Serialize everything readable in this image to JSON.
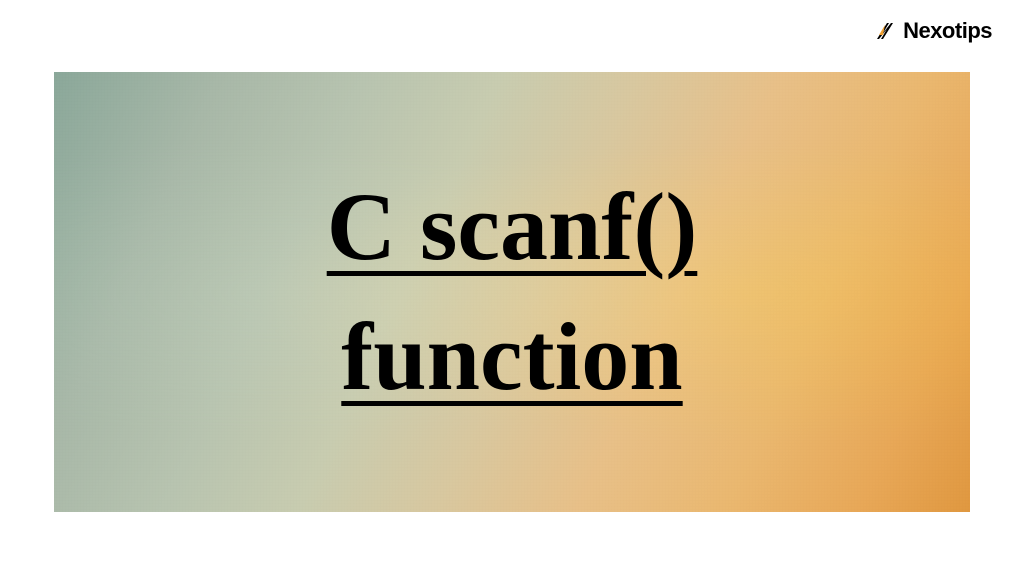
{
  "logo": {
    "text": "Nexotips",
    "icon_name": "nexotips-logo"
  },
  "banner": {
    "title_line1": "C scanf()",
    "title_line2": "function"
  }
}
